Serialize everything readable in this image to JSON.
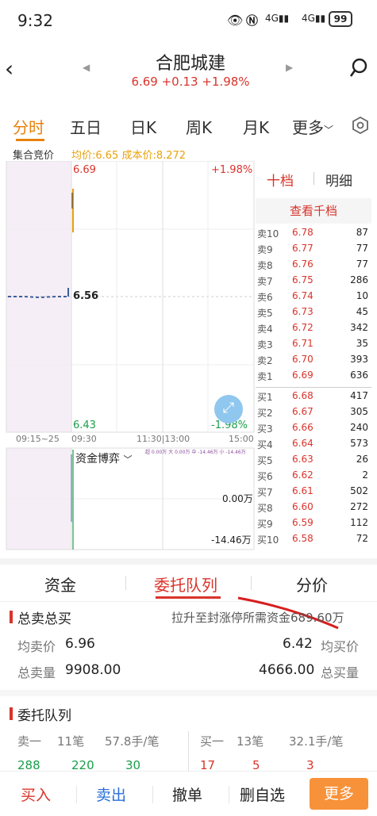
{
  "status": {
    "time": "9:32",
    "battery": "99"
  },
  "header": {
    "title": "合肥城建",
    "quote": "6.69 +0.13 +1.98%"
  },
  "tabs": [
    "分时",
    "五日",
    "日K",
    "周K",
    "月K",
    "更多"
  ],
  "chart": {
    "auction_label": "集合竞价",
    "avg_cost": "均价:6.65 成本价:8.272",
    "price_high": "6.69",
    "pct_high": "+1.98%",
    "price_mid": "6.56",
    "price_low": "6.43",
    "pct_low": "-1.98%",
    "time_labels": [
      "09:15~25",
      "09:30",
      "11:30|13:00",
      "15:00"
    ],
    "fund_label": "资金博弈",
    "fund_high": "0.00万",
    "fund_low": "-14.46万",
    "legend_mini": "超 0.00万  大 0.00万  中 -14.46万  小 -14.46万"
  },
  "orderbook": {
    "tab_ten": "十档",
    "tab_detail": "明细",
    "view_thousand": "查看千档",
    "sells": [
      {
        "label": "卖10",
        "price": "6.78",
        "vol": "87"
      },
      {
        "label": "卖9",
        "price": "6.77",
        "vol": "77"
      },
      {
        "label": "卖8",
        "price": "6.76",
        "vol": "77"
      },
      {
        "label": "卖7",
        "price": "6.75",
        "vol": "286"
      },
      {
        "label": "卖6",
        "price": "6.74",
        "vol": "10"
      },
      {
        "label": "卖5",
        "price": "6.73",
        "vol": "45"
      },
      {
        "label": "卖4",
        "price": "6.72",
        "vol": "342"
      },
      {
        "label": "卖3",
        "price": "6.71",
        "vol": "35"
      },
      {
        "label": "卖2",
        "price": "6.70",
        "vol": "393"
      },
      {
        "label": "卖1",
        "price": "6.69",
        "vol": "636"
      }
    ],
    "buys": [
      {
        "label": "买1",
        "price": "6.68",
        "vol": "417"
      },
      {
        "label": "买2",
        "price": "6.67",
        "vol": "305"
      },
      {
        "label": "买3",
        "price": "6.66",
        "vol": "240"
      },
      {
        "label": "买4",
        "price": "6.64",
        "vol": "573"
      },
      {
        "label": "买5",
        "price": "6.63",
        "vol": "26"
      },
      {
        "label": "买6",
        "price": "6.62",
        "vol": "2"
      },
      {
        "label": "买7",
        "price": "6.61",
        "vol": "502"
      },
      {
        "label": "买8",
        "price": "6.60",
        "vol": "272"
      },
      {
        "label": "买9",
        "price": "6.59",
        "vol": "112"
      },
      {
        "label": "买10",
        "price": "6.58",
        "vol": "72"
      }
    ]
  },
  "section_tabs": [
    "资金",
    "委托队列",
    "分价"
  ],
  "summary": {
    "title": "总卖总买",
    "hint": "拉升至封涨停所需资金689.60万",
    "avg_sell_label": "均卖价",
    "avg_sell": "6.96",
    "avg_buy": "6.42",
    "avg_buy_label": "均买价",
    "total_sell_label": "总卖量",
    "total_sell": "9908.00",
    "total_buy": "4666.00",
    "total_buy_label": "总买量"
  },
  "queue": {
    "title": "委托队列",
    "sell1": "卖一",
    "sell1_count": "11笔",
    "sell1_avg": "57.8手/笔",
    "buy1": "买一",
    "buy1_count": "13笔",
    "buy1_avg": "32.1手/笔",
    "left_partial": [
      "288",
      "220",
      "30"
    ],
    "right_partial": [
      "17",
      "5",
      "3"
    ]
  },
  "bottom": [
    "买入",
    "卖出",
    "撤单",
    "删自选",
    "更多"
  ]
}
